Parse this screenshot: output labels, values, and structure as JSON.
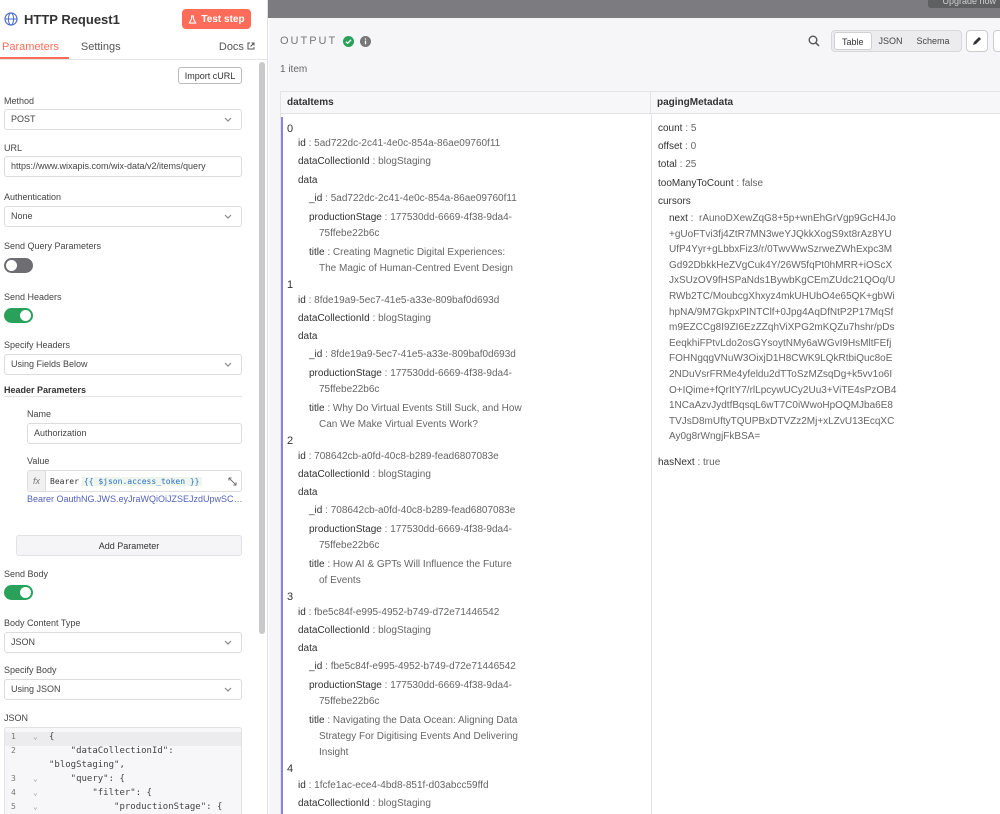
{
  "topbar": {
    "upgrade_label": "Upgrade now"
  },
  "node": {
    "title": "HTTP Request1",
    "test_step_label": "Test step",
    "tabs": [
      "Parameters",
      "Settings"
    ],
    "docs_label": "Docs",
    "import_curl_label": "Import cURL",
    "method": {
      "label": "Method",
      "value": "POST"
    },
    "url": {
      "label": "URL",
      "value": "https://www.wixapis.com/wix-data/v2/items/query"
    },
    "authentication": {
      "label": "Authentication",
      "value": "None"
    },
    "send_query_params": {
      "label": "Send Query Parameters",
      "enabled": false
    },
    "send_headers": {
      "label": "Send Headers",
      "enabled": true
    },
    "specify_headers": {
      "label": "Specify Headers",
      "value": "Using Fields Below"
    },
    "header_parameters": {
      "label": "Header Parameters",
      "name_label": "Name",
      "name_value": "Authorization",
      "value_label": "Value",
      "fx_label": "fx",
      "value_prefix": "Bearer",
      "value_expression": "{{ $json.access_token }}",
      "value_preview": "Bearer OauthNG.JWS.eyJraWQiOiJZSEJzdUpwSCIsIm..."
    },
    "add_parameter_label": "Add Parameter",
    "send_body": {
      "label": "Send Body",
      "enabled": true
    },
    "body_content_type": {
      "label": "Body Content Type",
      "value": "JSON"
    },
    "specify_body": {
      "label": "Specify Body",
      "value": "Using JSON"
    },
    "json_label": "JSON",
    "json_lines": [
      {
        "n": "1",
        "fold": "⌄",
        "text": "{"
      },
      {
        "n": "2",
        "fold": "",
        "text": "    \"dataCollectionId\":"
      },
      {
        "n": "",
        "fold": "",
        "text": "\"blogStaging\","
      },
      {
        "n": "3",
        "fold": "⌄",
        "text": "    \"query\": {"
      },
      {
        "n": "4",
        "fold": "⌄",
        "text": "        \"filter\": {"
      },
      {
        "n": "5",
        "fold": "⌄",
        "text": "            \"productionStage\": {"
      }
    ]
  },
  "output": {
    "title": "OUTPUT",
    "view_tabs": [
      "Table",
      "JSON",
      "Schema"
    ],
    "items_count": "1 item",
    "columns": [
      "dataItems",
      "pagingMetadata"
    ],
    "items": [
      {
        "index": "0",
        "id": "5ad722dc-2c41-4e0c-854a-86ae09760f11",
        "dataCollectionId": "blogStaging",
        "_id": "5ad722dc-2c41-4e0c-854a-86ae09760f11",
        "productionStage_1": "177530dd-6669-4f38-9da4-",
        "productionStage_2": "75ffebe22b6c",
        "title_1": "Creating Magnetic Digital Experiences:",
        "title_2": "The Magic of Human-Centred Event Design",
        "title_3": ""
      },
      {
        "index": "1",
        "id": "8fde19a9-5ec7-41e5-a33e-809baf0d693d",
        "dataCollectionId": "blogStaging",
        "_id": "8fde19a9-5ec7-41e5-a33e-809baf0d693d",
        "productionStage_1": "177530dd-6669-4f38-9da4-",
        "productionStage_2": "75ffebe22b6c",
        "title_1": "Why Do Virtual Events Still Suck, and How",
        "title_2": "Can We Make Virtual Events Work?",
        "title_3": ""
      },
      {
        "index": "2",
        "id": "708642cb-a0fd-40c8-b289-fead6807083e",
        "dataCollectionId": "blogStaging",
        "_id": "708642cb-a0fd-40c8-b289-fead6807083e",
        "productionStage_1": "177530dd-6669-4f38-9da4-",
        "productionStage_2": "75ffebe22b6c",
        "title_1": "How AI & GPTs Will Influence the Future",
        "title_2": "of Events",
        "title_3": ""
      },
      {
        "index": "3",
        "id": "fbe5c84f-e995-4952-b749-d72e71446542",
        "dataCollectionId": "blogStaging",
        "_id": "fbe5c84f-e995-4952-b749-d72e71446542",
        "productionStage_1": "177530dd-6669-4f38-9da4-",
        "productionStage_2": "75ffebe22b6c",
        "title_1": "Navigating the Data Ocean: Aligning Data",
        "title_2": "Strategy For Digitising Events And Delivering",
        "title_3": "Insight"
      },
      {
        "index": "4",
        "id": "1fcfe1ac-ece4-4bd8-851f-d03abcc59ffd",
        "dataCollectionId": "blogStaging"
      }
    ],
    "paging": {
      "count": "5",
      "offset": "0",
      "total": "25",
      "tooManyToCount": "false",
      "cursors_label": "cursors",
      "next": "rAunoDXewZqG8+5p+wnEhGrVgp9GcH4Jo+gUoFTvi3fj4ZtR7MN3weYJQkkXogS9xt8rAz8YUUfP4Yyr+gLbbxFiz3/r/0TwvWwSzrweZWhExpc3MGd92DbkkHeZVgCuk4Y/26W5fqPt0hMRR+iOScXJxSUzOV9fHSPaNds1BywbKgCEmZUdc21QOq/URWb2TC/MoubcgXhxyz4mkUHUbO4e65QK+gbWihpNA/9M7GkpxPINTClf+0Jpg4AqDfNtP2P17MqSfm9EZCCg8I9ZI6EzZZqhViXPG2mKQZu7hshr/pDsEeqkhiFPtvLdo2osGYsoytNMy6aWGvI9HsMltFEfjFOHNgqgVNuW3OixjD1H8CWK9LQkRtbiQuc8oE2NDuVsrFRMe4yfeldu2dTToSzMZsqDg+k5vv1o6IO+IQime+fQrItY7/rlLpcywUCy2Uu3+ViTE4sPzOB41NCaAzvJydtfBqsqL6wT7C0iWwoHpOQMJba6E8TVJsD8mUftyTQUPBxDTVZz2Mj+xLZvU13EcqXCAy0g8rWngjFkBSA=",
      "hasNext": "true"
    }
  }
}
